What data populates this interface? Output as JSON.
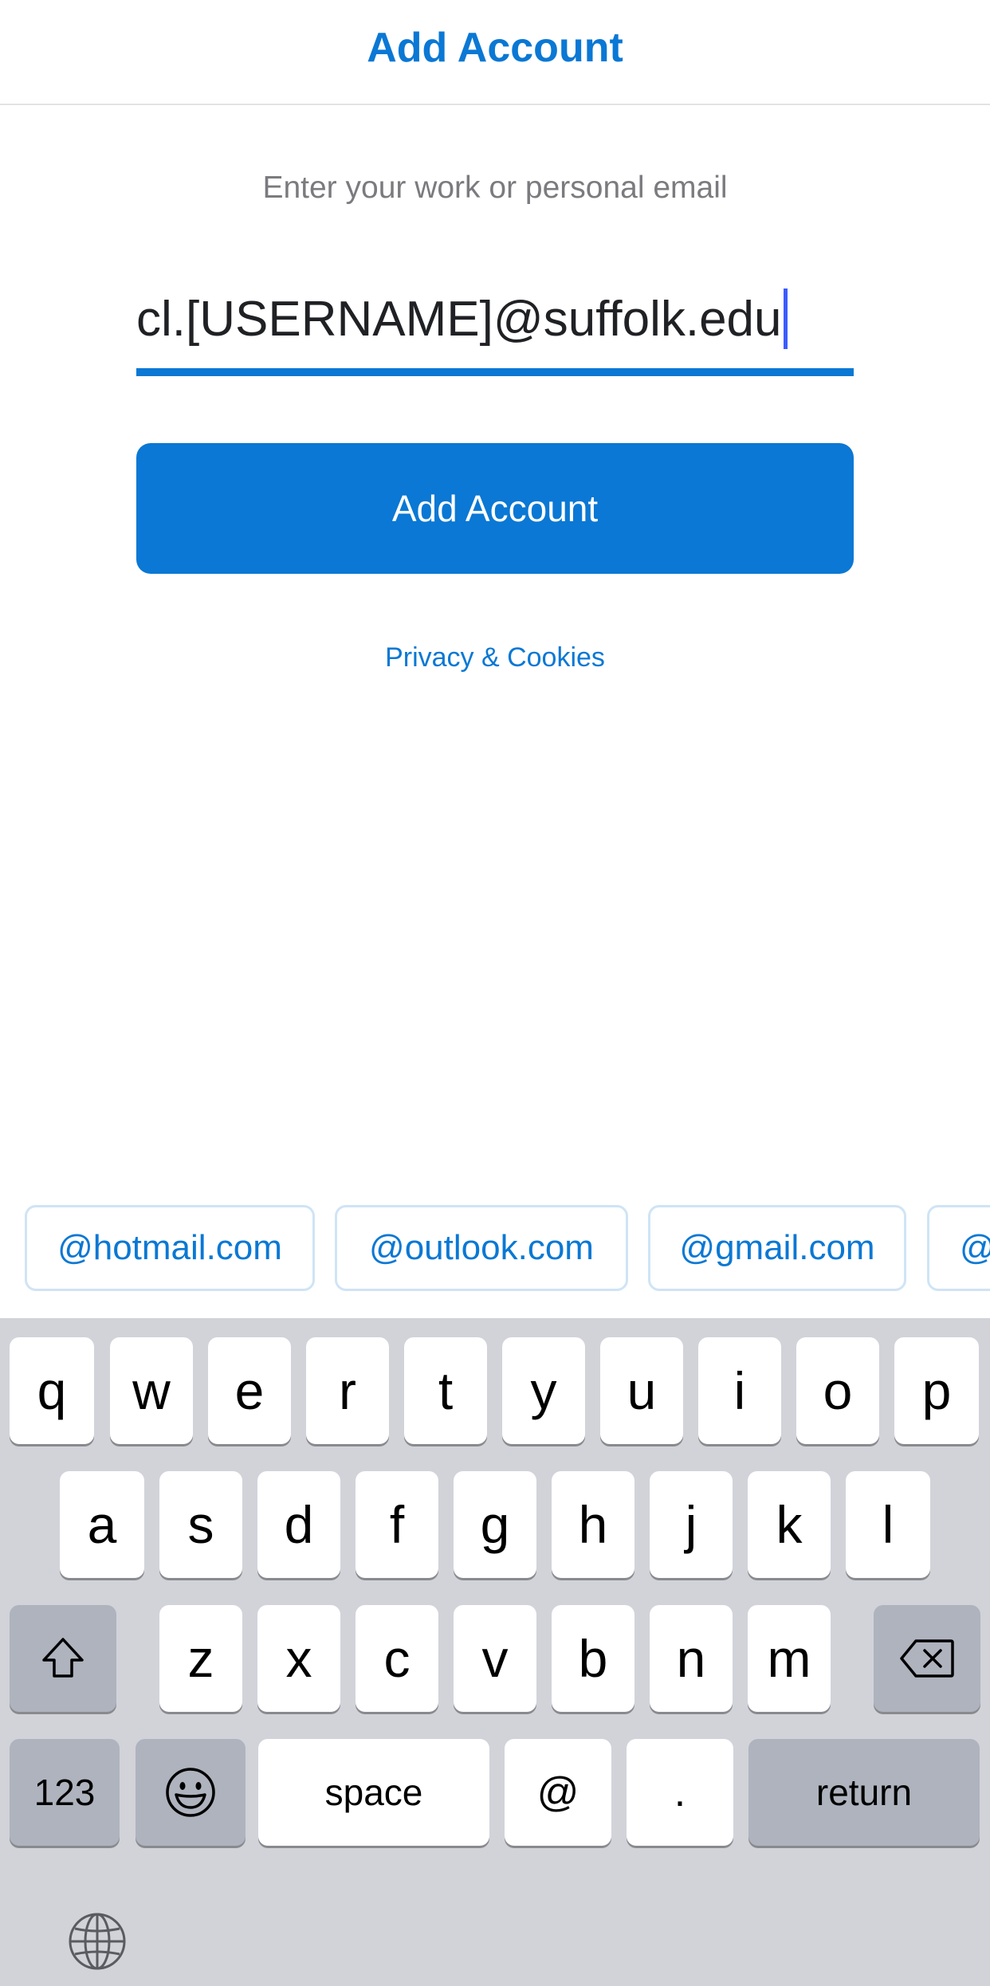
{
  "header": {
    "title": "Add Account"
  },
  "form": {
    "prompt": "Enter your work or personal email",
    "email_value": "cl.[USERNAME]@suffolk.edu",
    "add_button_label": "Add Account",
    "privacy_link": "Privacy & Cookies"
  },
  "suggestions": [
    "@hotmail.com",
    "@outlook.com",
    "@gmail.com",
    "@"
  ],
  "keyboard": {
    "row1": [
      "q",
      "w",
      "e",
      "r",
      "t",
      "y",
      "u",
      "i",
      "o",
      "p"
    ],
    "row2": [
      "a",
      "s",
      "d",
      "f",
      "g",
      "h",
      "j",
      "k",
      "l"
    ],
    "row3": [
      "z",
      "x",
      "c",
      "v",
      "b",
      "n",
      "m"
    ],
    "numbers_key": "123",
    "space_key": "space",
    "at_key": "@",
    "period_key": ".",
    "return_key": "return",
    "icons": {
      "shift": "shift-icon",
      "delete": "delete-icon",
      "emoji": "emoji-icon",
      "globe": "globe-icon"
    }
  },
  "colors": {
    "accent": "#0a78d4",
    "keyboard_bg": "#d1d3d9",
    "function_key_bg": "#aeb3be"
  }
}
